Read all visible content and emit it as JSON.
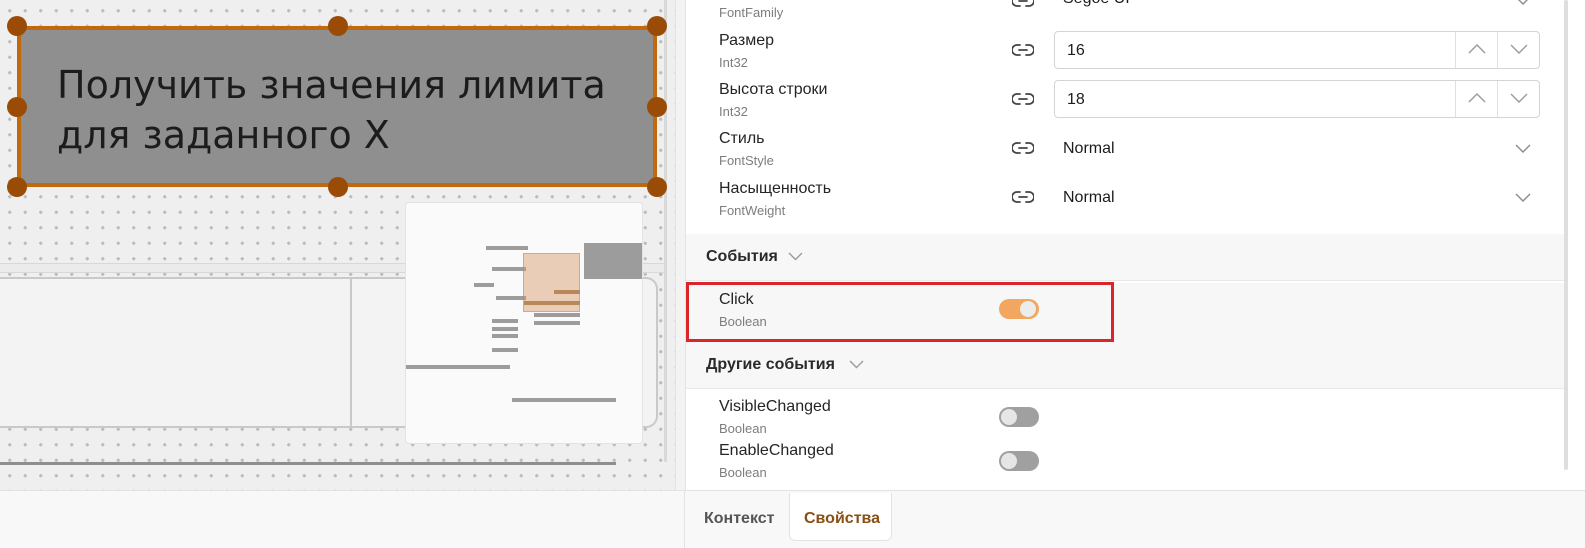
{
  "designer": {
    "selected_label_text": "Получить значения лимита для заданного X"
  },
  "properties": [
    {
      "name": "",
      "type": "FontFamily",
      "value": "Segoe UI",
      "kind": "select"
    },
    {
      "name": "Размер",
      "type": "Int32",
      "value": "16",
      "kind": "number"
    },
    {
      "name": "Высота строки",
      "type": "Int32",
      "value": "18",
      "kind": "number"
    },
    {
      "name": "Стиль",
      "type": "FontStyle",
      "value": "Normal",
      "kind": "select"
    },
    {
      "name": "Насыщенность",
      "type": "FontWeight",
      "value": "Normal",
      "kind": "select"
    }
  ],
  "sections": {
    "events": {
      "title": "События",
      "items": [
        {
          "name": "Click",
          "type": "Boolean",
          "enabled": true
        }
      ]
    },
    "other_events": {
      "title": "Другие события",
      "items": [
        {
          "name": "VisibleChanged",
          "type": "Boolean",
          "enabled": false
        },
        {
          "name": "EnableChanged",
          "type": "Boolean",
          "enabled": false
        }
      ]
    }
  },
  "tabs": [
    {
      "label": "Контекст",
      "active": false
    },
    {
      "label": "Свойства",
      "active": true
    }
  ],
  "colors": {
    "accent": "#8a4f14",
    "selection_border": "#c06a10",
    "toggle_on": "#f3a660",
    "highlight": "#d9262b"
  }
}
